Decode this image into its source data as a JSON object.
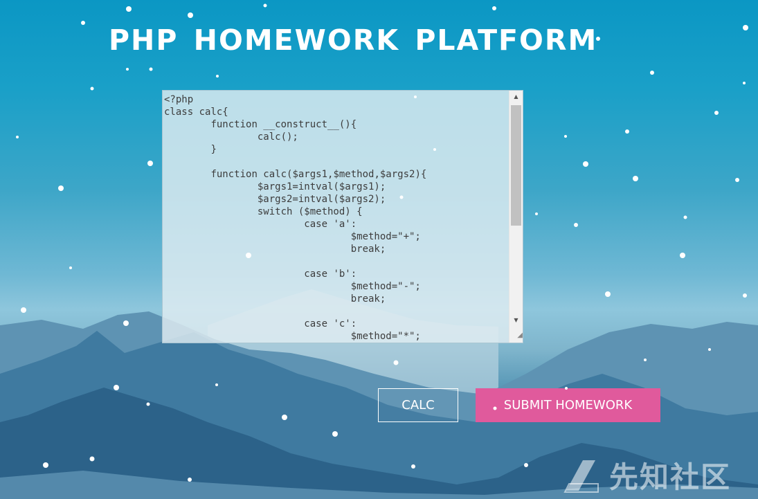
{
  "page": {
    "title": "PHP HOMEWORK PLATFORM"
  },
  "editor": {
    "code": "<?php\nclass calc{\n\tfunction __construct__(){\n\t\tcalc();\n\t}\n\n\tfunction calc($args1,$method,$args2){\n\t\t$args1=intval($args1);\n\t\t$args2=intval($args2);\n\t\tswitch ($method) {\n\t\t\tcase 'a':\n\t\t\t\t$method=\"+\";\n\t\t\t\tbreak;\n\n\t\t\tcase 'b':\n\t\t\t\t$method=\"-\";\n\t\t\t\tbreak;\n\n\t\t\tcase 'c':\n\t\t\t\t$method=\"*\";",
    "scroll_up_glyph": "▲",
    "scroll_down_glyph": "▼",
    "resize_glyph": "◢"
  },
  "buttons": {
    "calc_label": "CALC",
    "submit_label": "SUBMIT HOMEWORK"
  },
  "watermark": {
    "text": "先知社区"
  },
  "colors": {
    "submit_button": "#e05a9c",
    "sky_top": "#0b97c4",
    "mountain_dark": "#2f6f95"
  }
}
